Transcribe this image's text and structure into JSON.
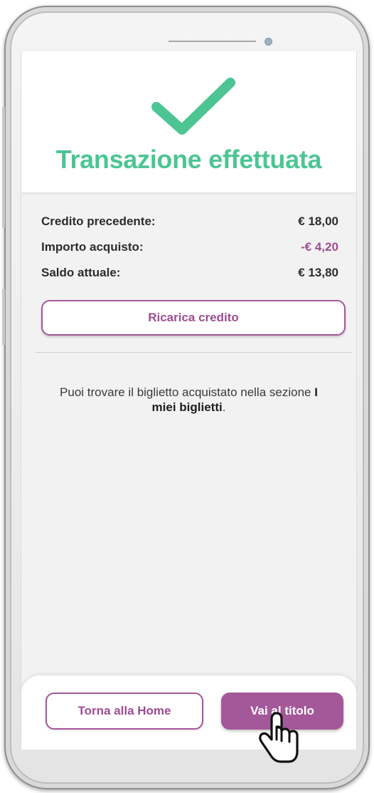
{
  "transaction": {
    "title": "Transazione effettuata",
    "rows": [
      {
        "label": "Credito precedente:",
        "value": "€ 18,00"
      },
      {
        "label": "Importo acquisto:",
        "value": "-€ 4,20"
      },
      {
        "label": "Saldo attuale:",
        "value": "€ 13,80"
      }
    ],
    "recharge_label": "Ricarica credito"
  },
  "info": {
    "text_before": "Puoi trovare il biglietto acquistato nella sezione ",
    "text_bold": "I miei biglietti",
    "text_after": "."
  },
  "footer": {
    "home_label": "Torna alla Home",
    "ticket_label": "Vai al titolo"
  },
  "icons": {
    "success": "check-icon",
    "pointer": "hand-pointer-icon"
  },
  "colors": {
    "success_green": "#4dc593",
    "accent_purple": "#a3589a",
    "negative_value": "#9d4d93"
  }
}
